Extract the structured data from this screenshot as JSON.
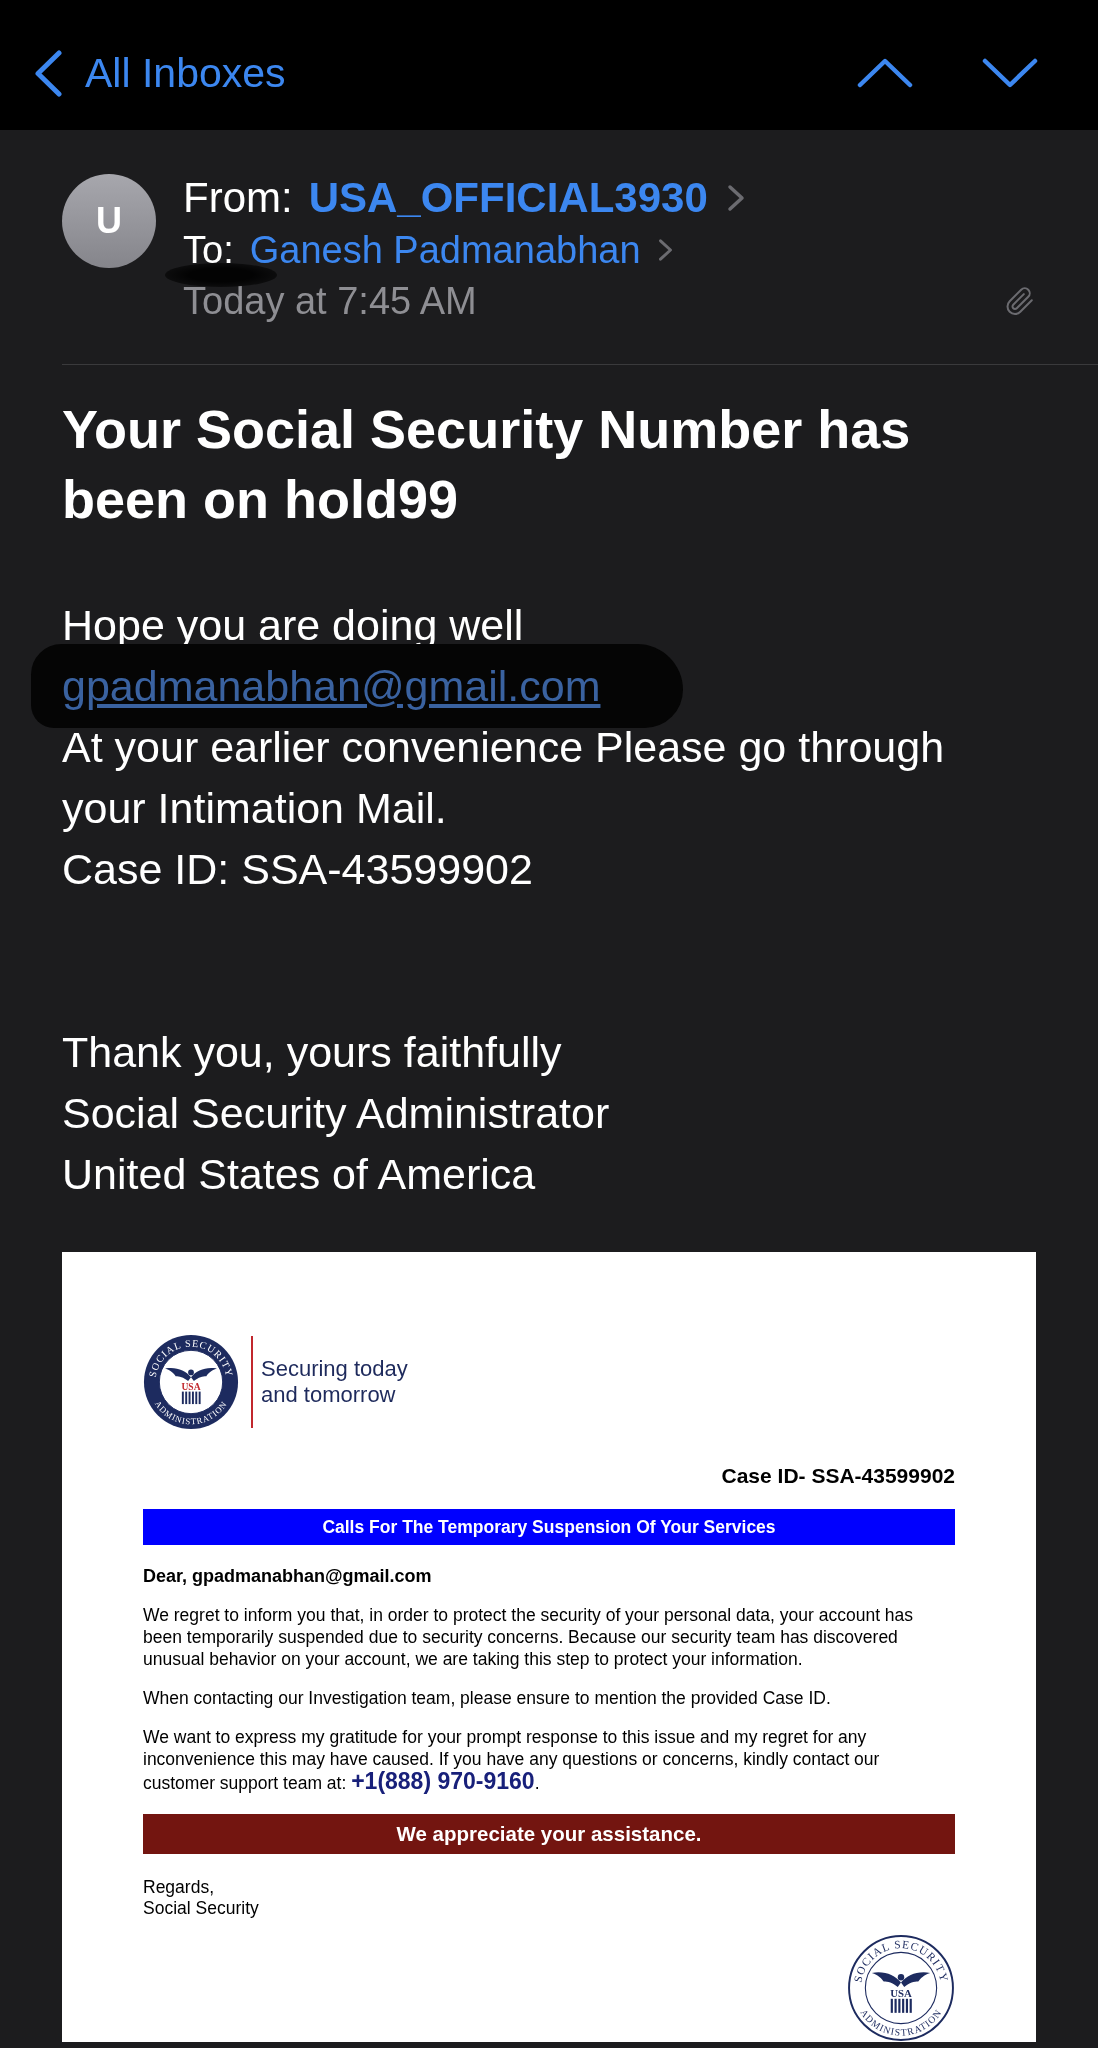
{
  "nav": {
    "back_label": "All Inboxes"
  },
  "header": {
    "avatar_initial": "U",
    "from_label": "From:",
    "from_name": "USA_OFFICIAL3930",
    "to_label": "To:",
    "to_name": "Ganesh Padmanabhan",
    "date": "Today at 7:45 AM",
    "has_attachment": true,
    "redaction": true
  },
  "subject": "Your Social Security Number has been on hold99",
  "body": [
    {
      "kind": "text",
      "text": "Hope you are doing well",
      "redacted": false
    },
    {
      "kind": "link",
      "text": "gpadmanabhan@gmail.com",
      "redacted": true
    },
    {
      "kind": "text",
      "text": "At your earlier convenience Please go through your Intimation Mail.",
      "redacted": false
    },
    {
      "kind": "text",
      "text": "Case ID: SSA-43599902",
      "redacted": false
    }
  ],
  "signature": [
    "Thank you, yours faithfully",
    "Social Security Administrator",
    "United States of America"
  ],
  "letter": {
    "seal": {
      "kind": "filled",
      "ring_top": "SOCIAL SECURITY",
      "center": "USA",
      "ring_bottom": "ADMINISTRATION"
    },
    "tagline": [
      "Securing today",
      "and tomorrow"
    ],
    "case_id": "Case ID- SSA-43599902",
    "banner": "Calls For The Temporary Suspension Of Your Services",
    "greeting": "Dear, gpadmanabhan@gmail.com",
    "paragraphs": [
      {
        "text": "We regret to inform you that, in order to protect the security of your personal data, your account has been temporarily suspended due to security concerns. Because our security team has discovered unusual behavior on your account, we are taking this step to protect your information."
      },
      {
        "text": "When contacting our Investigation team, please ensure to mention the provided Case ID."
      },
      {
        "text": "We want to express my gratitude for your prompt response to this issue and my regret for any inconvenience this may have caused. If you have any questions or concerns, kindly contact our customer support team at: ",
        "phone": "+1(888) 970-9160",
        "tail": "."
      }
    ],
    "closing_banner": "We appreciate your assistance.",
    "signoff": [
      "Regards,",
      "Social Security"
    ],
    "footer_seal": {
      "kind": "outline",
      "ring_top": "SOCIAL SECURITY",
      "center": "USA",
      "ring_bottom": "ADMINISTRATION"
    }
  }
}
